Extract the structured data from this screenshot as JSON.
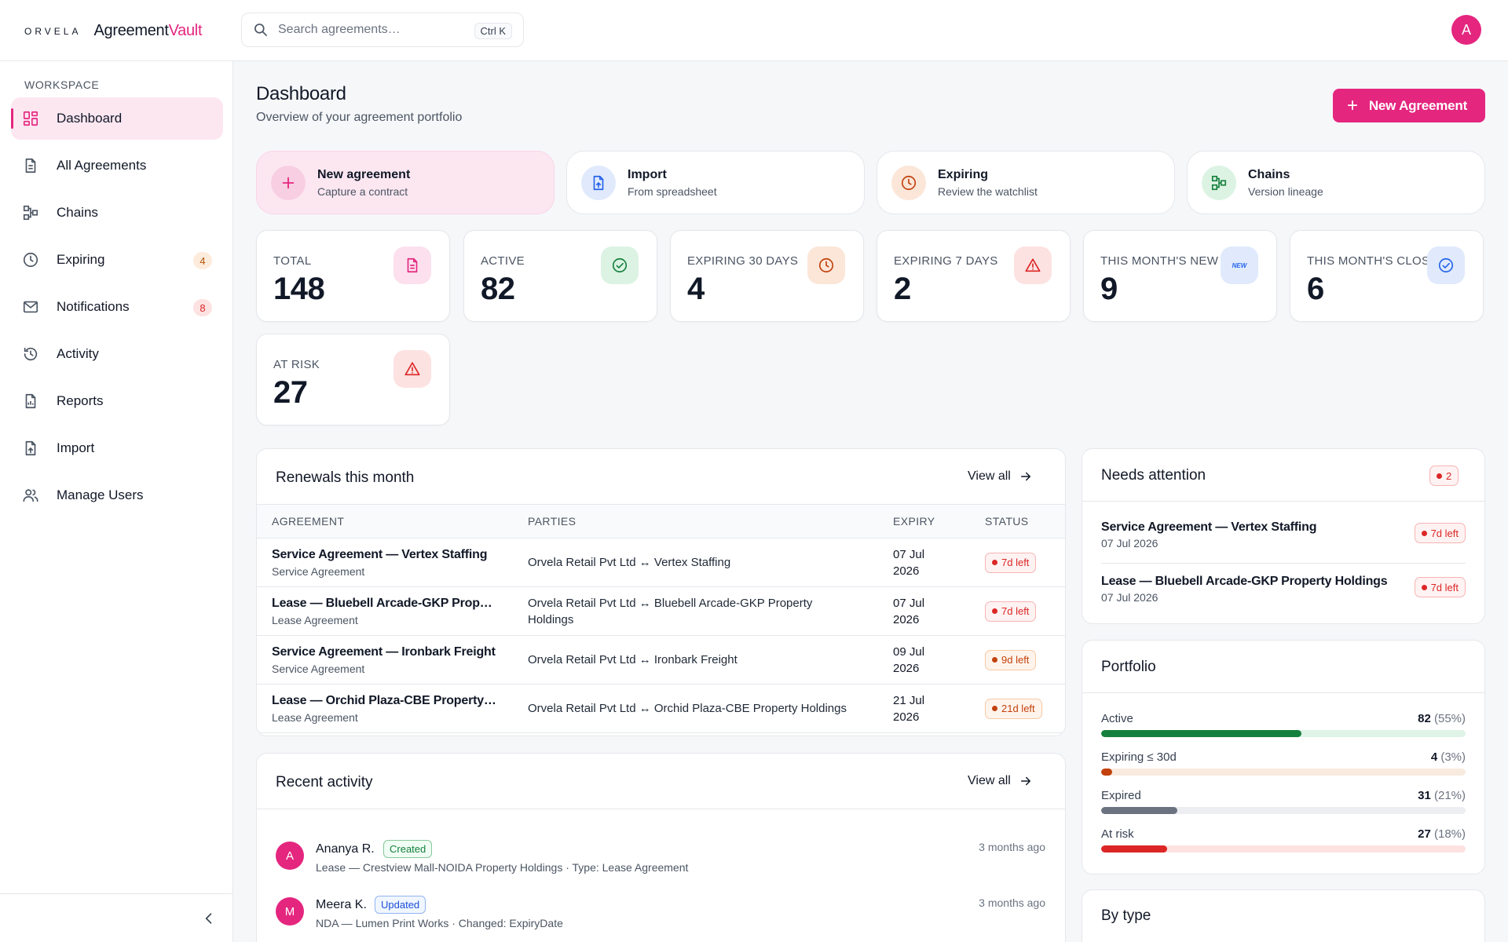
{
  "brand": {
    "mark": "ORVELA",
    "name_prefix": "Agreement",
    "name_suffix": "Vault",
    "accent": "#e4267f"
  },
  "search": {
    "placeholder": "Search agreements…",
    "shortcut": "Ctrl K"
  },
  "user": {
    "initial": "A"
  },
  "sidebar": {
    "section": "WORKSPACE",
    "items": [
      {
        "label": "Dashboard",
        "icon": "dashboard-icon",
        "active": true
      },
      {
        "label": "All Agreements",
        "icon": "document-icon"
      },
      {
        "label": "Chains",
        "icon": "chains-icon"
      },
      {
        "label": "Expiring",
        "icon": "clock-icon",
        "badge": "4"
      },
      {
        "label": "Notifications",
        "icon": "mail-icon",
        "badge": "8"
      },
      {
        "label": "Activity",
        "icon": "history-icon"
      },
      {
        "label": "Reports",
        "icon": "report-icon"
      },
      {
        "label": "Import",
        "icon": "import-icon"
      },
      {
        "label": "Manage Users",
        "icon": "users-icon"
      }
    ],
    "collapse_icon": "chevron-left-icon"
  },
  "header": {
    "title": "Dashboard",
    "subtitle": "Overview of your agreement portfolio",
    "new_button": "New Agreement"
  },
  "quick_actions": [
    {
      "title": "New agreement",
      "subtitle": "Capture a contract",
      "icon": "plus-icon"
    },
    {
      "title": "Import",
      "subtitle": "From spreadsheet",
      "icon": "file-upload-icon"
    },
    {
      "title": "Expiring",
      "subtitle": "Review the watchlist",
      "icon": "clock-icon"
    },
    {
      "title": "Chains",
      "subtitle": "Version lineage",
      "icon": "chains-icon"
    }
  ],
  "stats": [
    {
      "label": "TOTAL",
      "value": "148",
      "icon": "document-icon"
    },
    {
      "label": "ACTIVE",
      "value": "82",
      "icon": "check-circle-icon"
    },
    {
      "label": "EXPIRING 30 DAYS",
      "value": "4",
      "icon": "clock-icon"
    },
    {
      "label": "EXPIRING 7 DAYS",
      "value": "2",
      "icon": "warning-icon"
    },
    {
      "label": "THIS MONTH'S NEW",
      "value": "9",
      "icon": "new-badge-icon",
      "icon_text": "NEW"
    },
    {
      "label": "THIS MONTH'S CLOSED",
      "value": "6",
      "icon": "check-badge-icon"
    },
    {
      "label": "AT RISK",
      "value": "27",
      "icon": "warning-icon"
    }
  ],
  "renewals": {
    "title": "Renewals this month",
    "view_all": "View all",
    "columns": [
      "AGREEMENT",
      "PARTIES",
      "EXPIRY",
      "STATUS"
    ],
    "rows": [
      {
        "name": "Service Agreement — Vertex Staffing",
        "type": "Service Agreement",
        "parties": "Orvela Retail Pvt Ltd ↔ Vertex Staffing",
        "expiry_day": "07 Jul",
        "expiry_year": "2026",
        "status": "7d left",
        "tone": "red"
      },
      {
        "name": "Lease — Bluebell Arcade-GKP Prop…",
        "type": "Lease Agreement",
        "parties": "Orvela Retail Pvt Ltd ↔ Bluebell Arcade-GKP Property Holdings",
        "expiry_day": "07 Jul",
        "expiry_year": "2026",
        "status": "7d left",
        "tone": "red"
      },
      {
        "name": "Service Agreement — Ironbark Freight",
        "type": "Service Agreement",
        "parties": "Orvela Retail Pvt Ltd ↔ Ironbark Freight",
        "expiry_day": "09 Jul",
        "expiry_year": "2026",
        "status": "9d left",
        "tone": "orange"
      },
      {
        "name": "Lease — Orchid Plaza-CBE Property…",
        "type": "Lease Agreement",
        "parties": "Orvela Retail Pvt Ltd ↔ Orchid Plaza-CBE Property Holdings",
        "expiry_day": "21 Jul",
        "expiry_year": "2026",
        "status": "21d left",
        "tone": "orange"
      }
    ]
  },
  "activity": {
    "title": "Recent activity",
    "view_all": "View all",
    "items": [
      {
        "initial": "A",
        "name": "Ananya R.",
        "tag": "Created",
        "tone": "green",
        "desc": "Lease — Crestview Mall-NOIDA Property Holdings · Type: Lease Agreement",
        "time": "3 months ago"
      },
      {
        "initial": "M",
        "name": "Meera K.",
        "tag": "Updated",
        "tone": "blue",
        "desc": "NDA — Lumen Print Works · Changed: ExpiryDate",
        "time": "3 months ago"
      }
    ]
  },
  "attention": {
    "title": "Needs attention",
    "count": "2",
    "items": [
      {
        "name": "Service Agreement — Vertex Staffing",
        "date": "07 Jul 2026",
        "status": "7d left"
      },
      {
        "name": "Lease — Bluebell Arcade-GKP Property Holdings",
        "date": "07 Jul 2026",
        "status": "7d left"
      }
    ]
  },
  "portfolio": {
    "title": "Portfolio",
    "rows": [
      {
        "label": "Active",
        "value": "82",
        "pct": "(55%)",
        "fraction": 0.55,
        "color": "#15803d",
        "track": "#dff3e6"
      },
      {
        "label": "Expiring ≤ 30d",
        "value": "4",
        "pct": "(3%)",
        "fraction": 0.03,
        "color": "#c2410c",
        "track": "#f8eadf"
      },
      {
        "label": "Expired",
        "value": "31",
        "pct": "(21%)",
        "fraction": 0.21,
        "color": "#6b7280",
        "track": "#eceef1"
      },
      {
        "label": "At risk",
        "value": "27",
        "pct": "(18%)",
        "fraction": 0.18,
        "color": "#dc2626",
        "track": "#fde2e2"
      }
    ]
  },
  "by_type": {
    "title": "By type"
  }
}
